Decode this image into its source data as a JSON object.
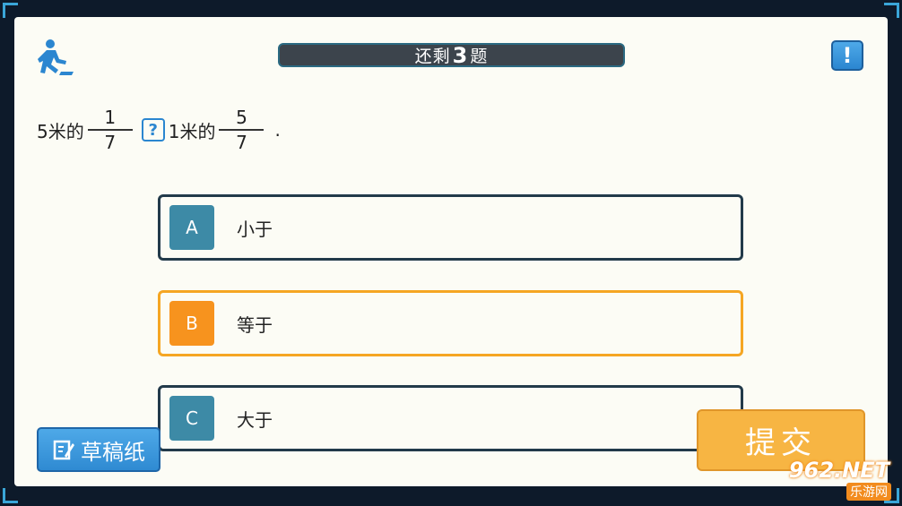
{
  "header": {
    "progress_prefix": "还剩",
    "progress_count": "3",
    "progress_suffix": "题",
    "help_label": "!"
  },
  "question": {
    "part1": "5米的",
    "frac1_num": "1",
    "frac1_den": "7",
    "blank": "?",
    "part2": "1米的",
    "frac2_num": "5",
    "frac2_den": "7",
    "end": "."
  },
  "options": [
    {
      "key": "A",
      "text": "小于"
    },
    {
      "key": "B",
      "text": "等于"
    },
    {
      "key": "C",
      "text": "大于"
    }
  ],
  "selected_option": "B",
  "buttons": {
    "scratch": "草稿纸",
    "submit": "提交"
  },
  "watermark": {
    "main": "962.NET",
    "sub": "乐游网"
  },
  "colors": {
    "accent_blue": "#2b86d0",
    "selected_orange": "#f7931e",
    "option_key": "#3d8aa6",
    "submit": "#f7b543"
  }
}
